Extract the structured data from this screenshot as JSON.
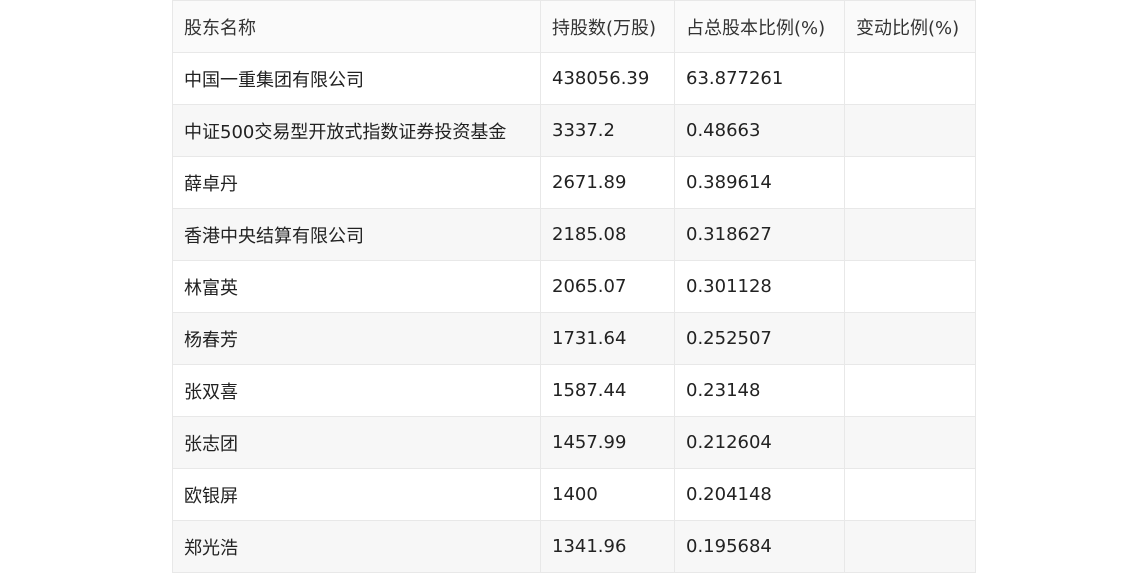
{
  "table": {
    "headers": [
      "股东名称",
      "持股数(万股)",
      "占总股本比例(%)",
      "变动比例(%)"
    ],
    "rows": [
      [
        "中国一重集团有限公司",
        "438056.39",
        "63.877261",
        ""
      ],
      [
        "中证500交易型开放式指数证券投资基金",
        "3337.2",
        "0.48663",
        ""
      ],
      [
        "薛卓丹",
        "2671.89",
        "0.389614",
        ""
      ],
      [
        "香港中央结算有限公司",
        "2185.08",
        "0.318627",
        ""
      ],
      [
        "林富英",
        "2065.07",
        "0.301128",
        ""
      ],
      [
        "杨春芳",
        "1731.64",
        "0.252507",
        ""
      ],
      [
        "张双喜",
        "1587.44",
        "0.23148",
        ""
      ],
      [
        "张志团",
        "1457.99",
        "0.212604",
        ""
      ],
      [
        "欧银屏",
        "1400",
        "0.204148",
        ""
      ],
      [
        "郑光浩",
        "1341.96",
        "0.195684",
        ""
      ]
    ]
  }
}
